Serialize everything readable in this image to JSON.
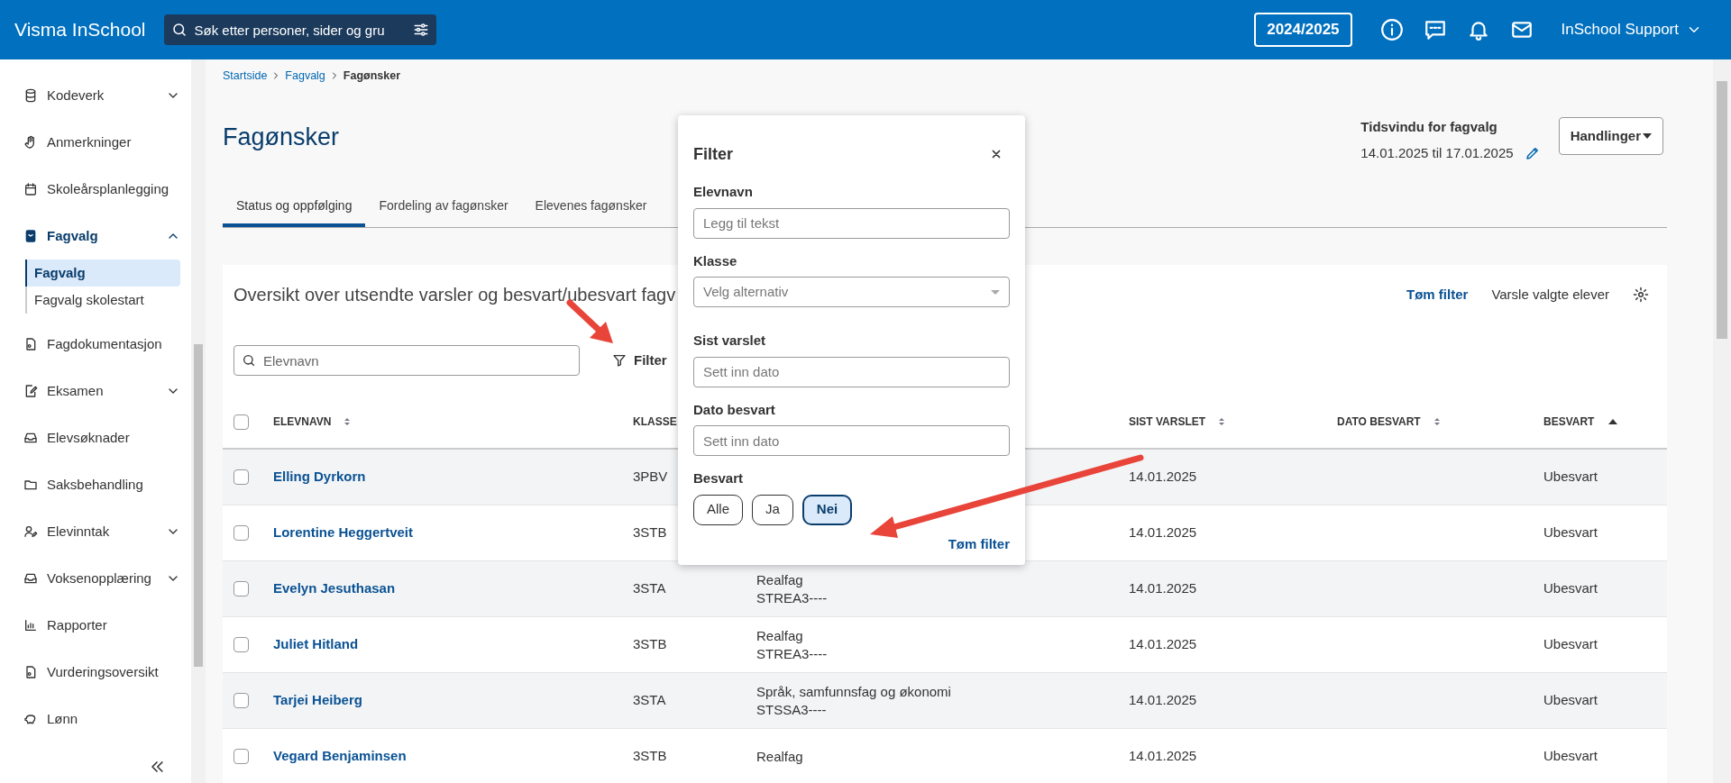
{
  "header": {
    "brand": "Visma InSchool",
    "search_placeholder": "Søk etter personer, sider og gru",
    "year": "2024/2025",
    "user": "InSchool Support"
  },
  "sidebar": {
    "items": [
      {
        "label": "Kodeverk",
        "expanded": false,
        "selected": false
      },
      {
        "label": "Anmerkninger",
        "selected": false
      },
      {
        "label": "Skoleårsplanlegging",
        "selected": false
      },
      {
        "label": "Fagvalg",
        "expanded": true,
        "selected": true,
        "children": [
          {
            "label": "Fagvalg",
            "selected": true
          },
          {
            "label": "Fagvalg skolestart",
            "selected": false
          }
        ]
      },
      {
        "label": "Fagdokumentasjon",
        "selected": false
      },
      {
        "label": "Eksamen",
        "expanded": false,
        "selected": false
      },
      {
        "label": "Elevsøknader",
        "selected": false
      },
      {
        "label": "Saksbehandling",
        "selected": false
      },
      {
        "label": "Elevinntak",
        "expanded": false,
        "selected": false
      },
      {
        "label": "Voksenopplæring",
        "expanded": false,
        "selected": false
      },
      {
        "label": "Rapporter",
        "selected": false
      },
      {
        "label": "Vurderingsoversikt",
        "selected": false
      },
      {
        "label": "Lønn",
        "selected": false
      }
    ]
  },
  "breadcrumb": [
    {
      "label": "Startside"
    },
    {
      "label": "Fagvalg"
    },
    {
      "label": "Fagønsker"
    }
  ],
  "page_title": "Fagønsker",
  "time_window": {
    "label": "Tidsvindu for fagvalg",
    "value": "14.01.2025 til 17.01.2025"
  },
  "actions_button": "Handlinger",
  "tabs": [
    {
      "label": "Status og oppfølging",
      "selected": true
    },
    {
      "label": "Fordeling av fagønsker",
      "selected": false
    },
    {
      "label": "Elevenes fagønsker",
      "selected": false
    }
  ],
  "card": {
    "title": "Oversikt over utsendte varsler og besvart/ubesvart fagv",
    "clear_filter": "Tøm filter",
    "notify": "Varsle valgte elever",
    "search_placeholder": "Elevnavn",
    "filter_button": "Filter"
  },
  "table": {
    "all_checked": false,
    "columns": [
      {
        "label": "ELEVNAVN",
        "sorted": false
      },
      {
        "label": "KLASSE"
      },
      {
        "label": "SIST VARSLET",
        "sorted": false
      },
      {
        "label": "DATO BESVART",
        "sorted": false
      },
      {
        "label": "BESVART",
        "sorted": true
      }
    ],
    "rows": [
      {
        "checked": false,
        "name": "Elling Dyrkorn",
        "klasse": "3PBV",
        "subject": [],
        "sist_varslet": "14.01.2025",
        "besvart": "Ubesvart"
      },
      {
        "checked": false,
        "name": "Lorentine Heggertveit",
        "klasse": "3STB",
        "subject": [],
        "sist_varslet": "14.01.2025",
        "besvart": "Ubesvart"
      },
      {
        "checked": false,
        "name": "Evelyn Jesuthasan",
        "klasse": "3STA",
        "subject": [
          "Realfag",
          "STREA3----"
        ],
        "sist_varslet": "14.01.2025",
        "besvart": "Ubesvart"
      },
      {
        "checked": false,
        "name": "Juliet Hitland",
        "klasse": "3STB",
        "subject": [
          "Realfag",
          "STREA3----"
        ],
        "sist_varslet": "14.01.2025",
        "besvart": "Ubesvart"
      },
      {
        "checked": false,
        "name": "Tarjei Heiberg",
        "klasse": "3STA",
        "subject": [
          "Språk, samfunnsfag og økonomi",
          "STSSA3----"
        ],
        "sist_varslet": "14.01.2025",
        "besvart": "Ubesvart"
      },
      {
        "checked": false,
        "name": "Vegard Benjaminsen",
        "klasse": "3STB",
        "subject": [
          "Realfag"
        ],
        "sist_varslet": "14.01.2025",
        "besvart": "Ubesvart"
      }
    ]
  },
  "filter_popup": {
    "title": "Filter",
    "fields": [
      {
        "kind": "text",
        "label": "Elevnavn",
        "placeholder": "Legg til tekst"
      },
      {
        "kind": "select",
        "label": "Klasse",
        "placeholder": "Velg alternativ"
      },
      {
        "kind": "text",
        "label": "Sist varslet",
        "placeholder": "Sett inn dato"
      },
      {
        "kind": "text",
        "label": "Dato besvart",
        "placeholder": "Sett inn dato"
      },
      {
        "kind": "toggle",
        "label": "Besvart",
        "options": [
          {
            "label": "Alle",
            "selected": false
          },
          {
            "label": "Ja",
            "selected": false
          },
          {
            "label": "Nei",
            "selected": true
          }
        ]
      }
    ],
    "clear": "Tøm filter"
  }
}
